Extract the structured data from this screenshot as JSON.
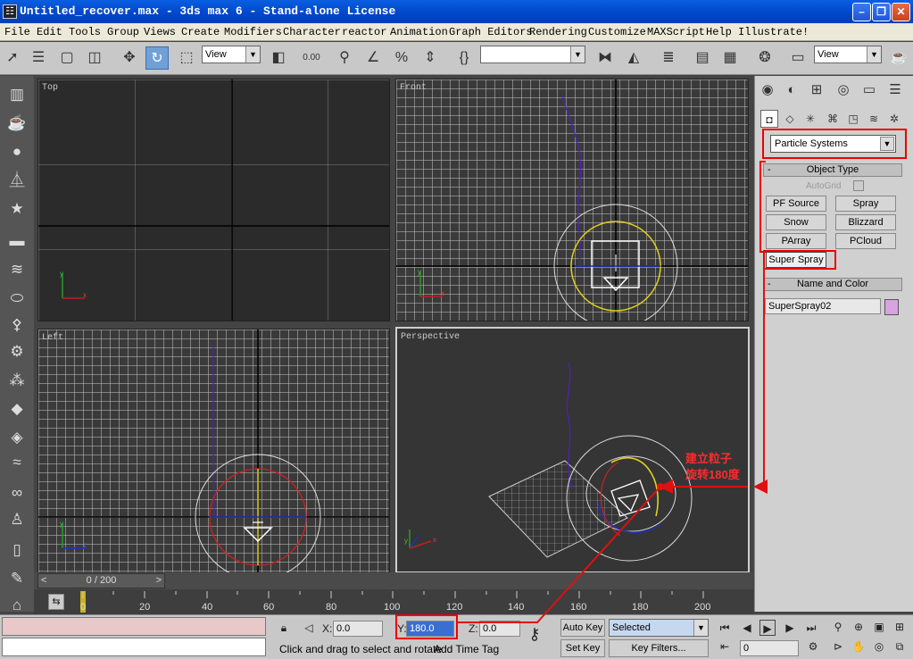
{
  "window": {
    "title": "Untitled_recover.max - 3ds max 6 - Stand-alone License",
    "icon_glyph": "☷",
    "minimize_glyph": "–",
    "maximize_glyph": "❐",
    "close_glyph": "✕"
  },
  "menu": [
    "File",
    "Edit",
    "Tools",
    "Group",
    "Views",
    "Create",
    "Modifiers",
    "Character",
    "reactor",
    "Animation",
    "Graph Editors",
    "Rendering",
    "Customize",
    "MAXScript",
    "Help",
    "Illustrate!"
  ],
  "toolbar": {
    "icons": [
      "select-arrow",
      "select-by-name",
      "rect-select",
      "window-crossing",
      "move",
      "rotate",
      "scale",
      "ref-coord",
      "pivot",
      "snaps",
      "angle-snap",
      "percent-snap",
      "spinner-snap",
      "named-selection",
      "mirror",
      "align",
      "layers",
      "curve-editor",
      "schematic",
      "material-editor",
      "render-scene",
      "quick-render"
    ],
    "coord_dropdown": "View",
    "render_dropdown": "View",
    "named_set_dropdown": "",
    "spinner_snap_value": "0.00"
  },
  "viewports": {
    "top": "Top",
    "front": "Front",
    "left": "Left",
    "perspective": "Perspective"
  },
  "command_panel": {
    "category_dropdown": "Particle Systems",
    "object_type_title": "Object Type",
    "autogrid_label": "AutoGrid",
    "object_buttons": [
      "PF Source",
      "Spray",
      "Snow",
      "Blizzard",
      "PArray",
      "PCloud"
    ],
    "super_spray_button": "Super Spray",
    "name_color_title": "Name and Color",
    "object_name": "SuperSpray02",
    "object_color": "#d8a4e0"
  },
  "timeline": {
    "frame_display": "0 / 200",
    "ticks": [
      "0",
      "20",
      "40",
      "60",
      "80",
      "100",
      "120",
      "140",
      "160",
      "180",
      "200"
    ]
  },
  "status": {
    "x_label": "X:",
    "x_value": "0.0",
    "y_label": "Y:",
    "y_value": "180.0",
    "z_label": "Z:",
    "z_value": "0.0",
    "prompt": "Click and drag to select and rotate",
    "add_time_tag": "Add Time Tag",
    "auto_key": "Auto Key",
    "set_key": "Set Key",
    "key_mode_dropdown": "Selected",
    "key_filters": "Key Filters...",
    "current_frame": "0"
  },
  "annotation": {
    "line1": "建立粒子",
    "line2": "旋转180度",
    "color": "#ff2020"
  }
}
